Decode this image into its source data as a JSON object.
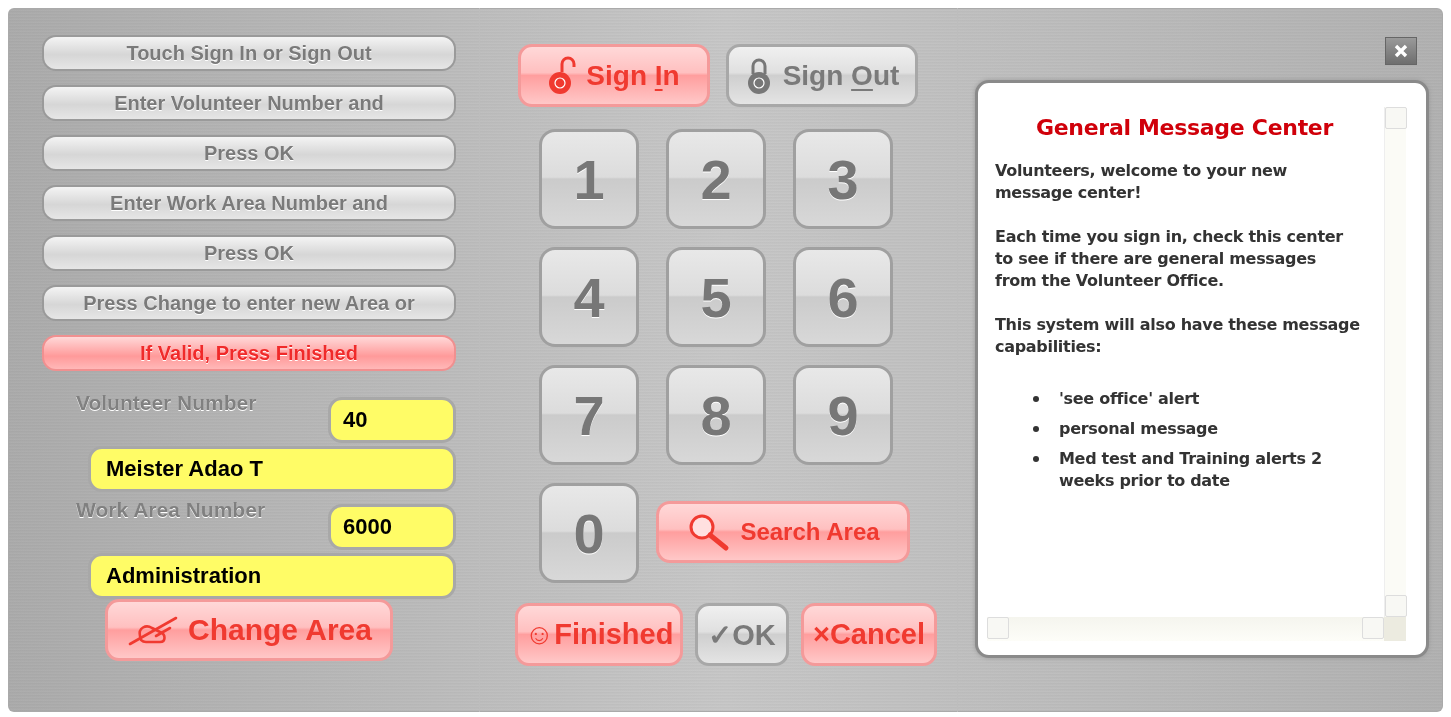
{
  "instructions": [
    {
      "text": "Touch Sign In or Sign Out",
      "active": false
    },
    {
      "text": "Enter Volunteer Number and",
      "active": false
    },
    {
      "text": "Press OK",
      "active": false
    },
    {
      "text": "Enter Work Area Number and",
      "active": false
    },
    {
      "text": "Press OK",
      "active": false
    },
    {
      "text": "Press Change to enter new Area or",
      "active": false
    },
    {
      "text": "If Valid, Press Finished",
      "active": true
    }
  ],
  "volunteer": {
    "label": "Volunteer Number",
    "number": "40",
    "name": "Meister Adao T"
  },
  "work_area": {
    "label": "Work Area Number",
    "number": "6000",
    "name": "Administration"
  },
  "change_area_button": {
    "label": "Change Area",
    "active": true
  },
  "mode_buttons": [
    {
      "kind": "sign-in",
      "label_start": "Sign ",
      "access_key": "I",
      "label_end": "n",
      "selected": true
    },
    {
      "kind": "sign-out",
      "label_start": "Sign ",
      "access_key": "O",
      "label_end": "ut",
      "selected": false
    }
  ],
  "keypad": [
    "1",
    "2",
    "3",
    "4",
    "5",
    "6",
    "7",
    "8",
    "9",
    "0"
  ],
  "search_button": {
    "label": "Search Area",
    "active": true
  },
  "action_buttons": [
    {
      "label": "☺Finished",
      "active": true
    },
    {
      "label": "✓OK",
      "active": false
    },
    {
      "label": "×Cancel",
      "active": true
    }
  ],
  "message_center": {
    "title": "General Message Center",
    "paragraphs": [
      "Volunteers, welcome to your new message center!",
      "Each time you sign in, check this center to see if there are general messages from the Volunteer Office.",
      "This system will also have these message capabilities:"
    ],
    "bullets": [
      "'see office' alert",
      "personal message",
      "Med test and Training alerts 2 weeks prior to date"
    ]
  }
}
